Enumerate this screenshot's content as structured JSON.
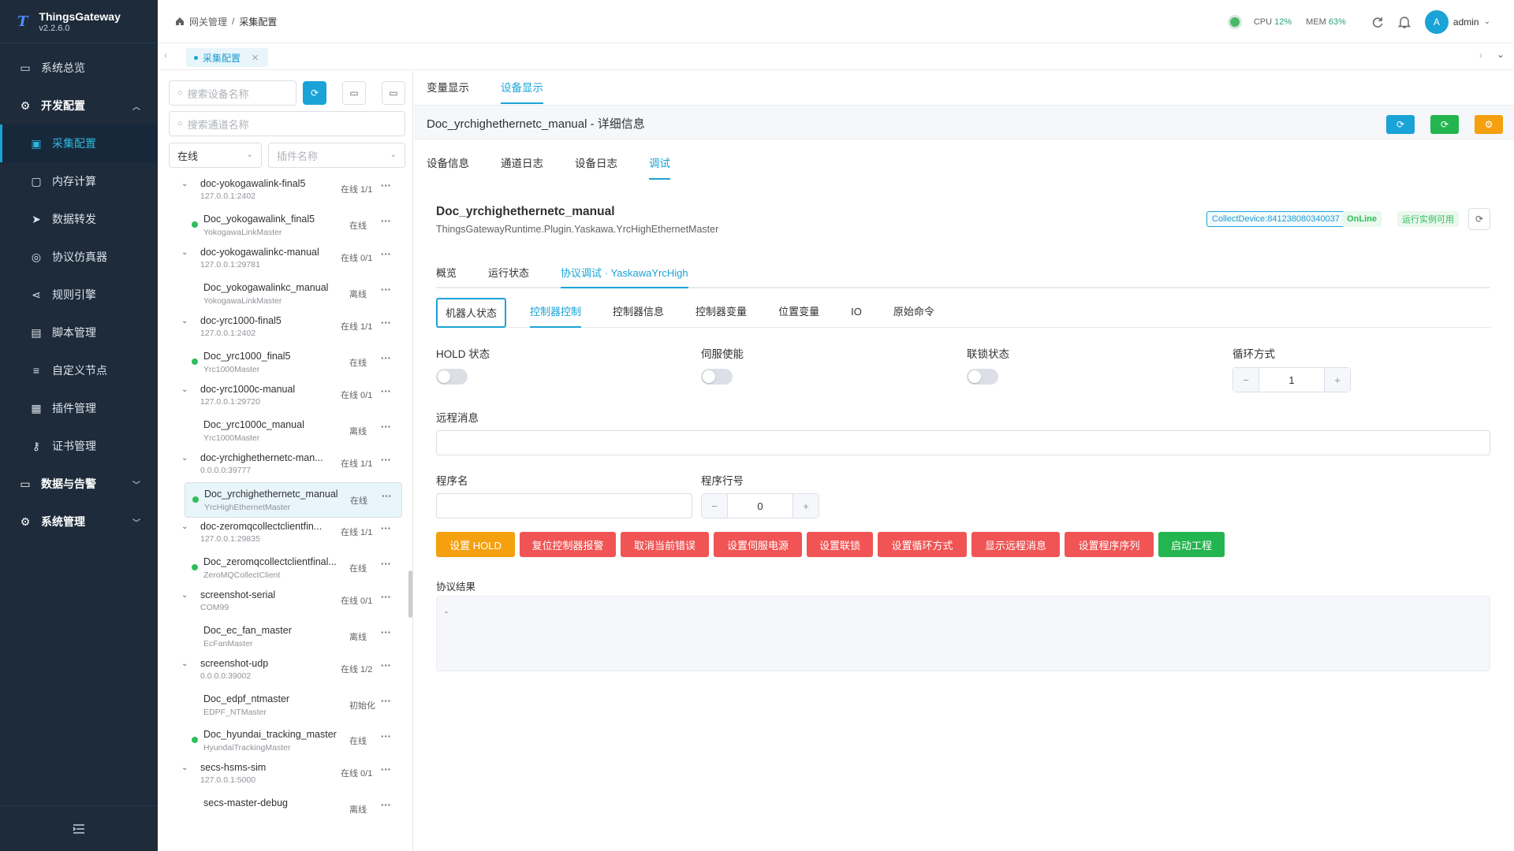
{
  "brand": {
    "name": "ThingsGateway",
    "version": "v2.2.6.0",
    "logo": "T"
  },
  "sidebar": {
    "items": [
      {
        "label": "系统总览",
        "icon": "monitor-icon",
        "type": "top"
      },
      {
        "label": "开发配置",
        "icon": "gear-icon",
        "type": "group",
        "expanded": true
      },
      {
        "label": "采集配置",
        "icon": "collect-icon",
        "type": "sub",
        "active": true
      },
      {
        "label": "内存计算",
        "icon": "chip-icon",
        "type": "sub"
      },
      {
        "label": "数据转发",
        "icon": "send-icon",
        "type": "sub"
      },
      {
        "label": "协议仿真器",
        "icon": "simulator-icon",
        "type": "sub"
      },
      {
        "label": "规则引擎",
        "icon": "share-icon",
        "type": "sub"
      },
      {
        "label": "脚本管理",
        "icon": "document-icon",
        "type": "sub"
      },
      {
        "label": "自定义节点",
        "icon": "sliders-icon",
        "type": "sub"
      },
      {
        "label": "插件管理",
        "icon": "plugin-icon",
        "type": "sub"
      },
      {
        "label": "证书管理",
        "icon": "key-icon",
        "type": "sub"
      },
      {
        "label": "数据与告警",
        "icon": "monitor-icon",
        "type": "group"
      },
      {
        "label": "系统管理",
        "icon": "gear-icon",
        "type": "group"
      }
    ]
  },
  "header": {
    "breadcrumb_root": "网关管理",
    "breadcrumb_sep": "/",
    "breadcrumb_current": "采集配置",
    "cpu_label": "CPU",
    "cpu_value": "12%",
    "mem_label": "MEM",
    "mem_value": "63%",
    "user_initial": "A",
    "user_name": "admin"
  },
  "tabs_bar": {
    "open_tab": "采集配置"
  },
  "left_panel": {
    "search_device_placeholder": "搜索设备名称",
    "search_channel_placeholder": "搜索通道名称",
    "status_select": "在线",
    "plugin_select_placeholder": "插件名称",
    "tree": [
      {
        "kind": "node",
        "name": "doc-yokogawalink-final5",
        "addr": "127.0.0.1:2402",
        "status": "在线 1/1"
      },
      {
        "kind": "leaf",
        "name": "Doc_yokogawalink_final5",
        "plugin": "YokogawaLinkMaster",
        "status": "在线",
        "online": true
      },
      {
        "kind": "node",
        "name": "doc-yokogawalinkc-manual",
        "addr": "127.0.0.1:29781",
        "status": "在线 0/1"
      },
      {
        "kind": "leaf",
        "name": "Doc_yokogawalinkc_manual",
        "plugin": "YokogawaLinkMaster",
        "status": "离线",
        "online": false
      },
      {
        "kind": "node",
        "name": "doc-yrc1000-final5",
        "addr": "127.0.0.1:2402",
        "status": "在线 1/1"
      },
      {
        "kind": "leaf",
        "name": "Doc_yrc1000_final5",
        "plugin": "Yrc1000Master",
        "status": "在线",
        "online": true
      },
      {
        "kind": "node",
        "name": "doc-yrc1000c-manual",
        "addr": "127.0.0.1:29720",
        "status": "在线 0/1"
      },
      {
        "kind": "leaf",
        "name": "Doc_yrc1000c_manual",
        "plugin": "Yrc1000Master",
        "status": "离线",
        "online": false
      },
      {
        "kind": "node",
        "name": "doc-yrchighethernetc-man...",
        "addr": "0.0.0.0:39777",
        "status": "在线 1/1"
      },
      {
        "kind": "leaf",
        "name": "Doc_yrchighethernetc_manual",
        "plugin": "YrcHighEthernetMaster",
        "status": "在线",
        "online": true,
        "selected": true
      },
      {
        "kind": "node",
        "name": "doc-zeromqcollectclientfin...",
        "addr": "127.0.0.1:29835",
        "status": "在线 1/1"
      },
      {
        "kind": "leaf",
        "name": "Doc_zeromqcollectclientfinal...",
        "plugin": "ZeroMQCollectClient",
        "status": "在线",
        "online": true
      },
      {
        "kind": "node",
        "name": "screenshot-serial",
        "addr": "COM99",
        "status": "在线 0/1"
      },
      {
        "kind": "leaf",
        "name": "Doc_ec_fan_master",
        "plugin": "EcFanMaster",
        "status": "离线",
        "online": false
      },
      {
        "kind": "node",
        "name": "screenshot-udp",
        "addr": "0.0.0.0:39002",
        "status": "在线 1/2"
      },
      {
        "kind": "leaf",
        "name": "Doc_edpf_ntmaster",
        "plugin": "EDPF_NTMaster",
        "status": "初始化",
        "online": false
      },
      {
        "kind": "leaf",
        "name": "Doc_hyundai_tracking_master",
        "plugin": "HyundaiTrackingMaster",
        "status": "在线",
        "online": true
      },
      {
        "kind": "node",
        "name": "secs-hsms-sim",
        "addr": "127.0.0.1:5000",
        "status": "在线 0/1"
      },
      {
        "kind": "leaf",
        "name": "secs-master-debug",
        "plugin": "",
        "status": "离线",
        "online": false
      }
    ]
  },
  "main": {
    "top_tabs": [
      "变量显示",
      "设备显示"
    ],
    "top_tab_active": 1,
    "title": "Doc_yrchighethernetc_manual - 详细信息",
    "sub_tabs": [
      "设备信息",
      "通道日志",
      "设备日志",
      "调试"
    ],
    "sub_tab_active": 3,
    "device": {
      "name": "Doc_yrchighethernetc_manual",
      "plugin_path": "ThingsGatewayRuntime.Plugin.Yaskawa.YrcHighEthernetMaster",
      "collect_tag": "CollectDevice:841238080340037",
      "online_tag": "OnLine",
      "runtime_tag": "运行实例可用"
    },
    "inner_tabs": [
      "概览",
      "运行状态",
      "协议调试 · YaskawaYrcHigh"
    ],
    "inner_tab_active": 2,
    "cmd_tabs": [
      "机器人状态",
      "控制器控制",
      "控制器信息",
      "控制器变量",
      "位置变量",
      "IO",
      "原始命令"
    ],
    "cmd_tab_active": 1,
    "form": {
      "hold_label": "HOLD 状态",
      "servo_label": "伺服使能",
      "interlock_label": "联锁状态",
      "cycle_label": "循环方式",
      "cycle_value": "1",
      "remote_msg_label": "远程消息",
      "program_name_label": "程序名",
      "program_line_label": "程序行号",
      "program_line_value": "0"
    },
    "actions": [
      {
        "label": "设置 HOLD",
        "color": "#f5a00f"
      },
      {
        "label": "复位控制器报警",
        "color": "#f05454"
      },
      {
        "label": "取消当前错误",
        "color": "#f05454"
      },
      {
        "label": "设置伺服电源",
        "color": "#f05454"
      },
      {
        "label": "设置联锁",
        "color": "#f05454"
      },
      {
        "label": "设置循环方式",
        "color": "#f05454"
      },
      {
        "label": "显示远程消息",
        "color": "#f05454"
      },
      {
        "label": "设置程序序列",
        "color": "#f05454"
      },
      {
        "label": "启动工程",
        "color": "#23b54f"
      }
    ],
    "result_label": "协议结果",
    "result_value": "-"
  },
  "colors": {
    "accent": "#1aa3d6",
    "success": "#2ebd5a",
    "danger": "#f05454",
    "warning": "#f5a00f",
    "sidebar": "#1d2b3a"
  }
}
